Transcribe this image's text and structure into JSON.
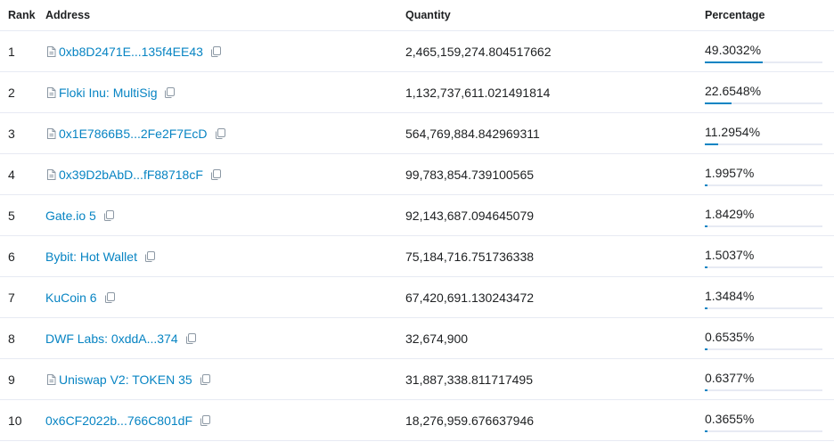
{
  "header": {
    "rank": "Rank",
    "address": "Address",
    "quantity": "Quantity",
    "percentage": "Percentage"
  },
  "colors": {
    "link": "#0784c3",
    "bar_fill": "#0784c3",
    "bar_track": "#e7eaf3",
    "divider": "#e7eaf3"
  },
  "rows": [
    {
      "rank": "1",
      "address": "0xb8D2471E...135f4EE43",
      "contract_icon": true,
      "quantity": "2,465,159,274.804517662",
      "percentage": "49.3032%",
      "pct_value": 49.3032
    },
    {
      "rank": "2",
      "address": "Floki Inu: MultiSig",
      "contract_icon": true,
      "quantity": "1,132,737,611.021491814",
      "percentage": "22.6548%",
      "pct_value": 22.6548
    },
    {
      "rank": "3",
      "address": "0x1E7866B5...2Fe2F7EcD",
      "contract_icon": true,
      "quantity": "564,769,884.842969311",
      "percentage": "11.2954%",
      "pct_value": 11.2954
    },
    {
      "rank": "4",
      "address": "0x39D2bAbD...fF88718cF",
      "contract_icon": true,
      "quantity": "99,783,854.739100565",
      "percentage": "1.9957%",
      "pct_value": 1.9957
    },
    {
      "rank": "5",
      "address": "Gate.io 5",
      "contract_icon": false,
      "quantity": "92,143,687.094645079",
      "percentage": "1.8429%",
      "pct_value": 1.8429
    },
    {
      "rank": "6",
      "address": "Bybit: Hot Wallet",
      "contract_icon": false,
      "quantity": "75,184,716.751736338",
      "percentage": "1.5037%",
      "pct_value": 1.5037
    },
    {
      "rank": "7",
      "address": "KuCoin 6",
      "contract_icon": false,
      "quantity": "67,420,691.130243472",
      "percentage": "1.3484%",
      "pct_value": 1.3484
    },
    {
      "rank": "8",
      "address": "DWF Labs: 0xddA...374",
      "contract_icon": false,
      "quantity": "32,674,900",
      "percentage": "0.6535%",
      "pct_value": 0.6535
    },
    {
      "rank": "9",
      "address": "Uniswap V2: TOKEN 35",
      "contract_icon": true,
      "quantity": "31,887,338.811717495",
      "percentage": "0.6377%",
      "pct_value": 0.6377
    },
    {
      "rank": "10",
      "address": "0x6CF2022b...766C801dF",
      "contract_icon": false,
      "quantity": "18,276,959.676637946",
      "percentage": "0.3655%",
      "pct_value": 0.3655
    }
  ]
}
